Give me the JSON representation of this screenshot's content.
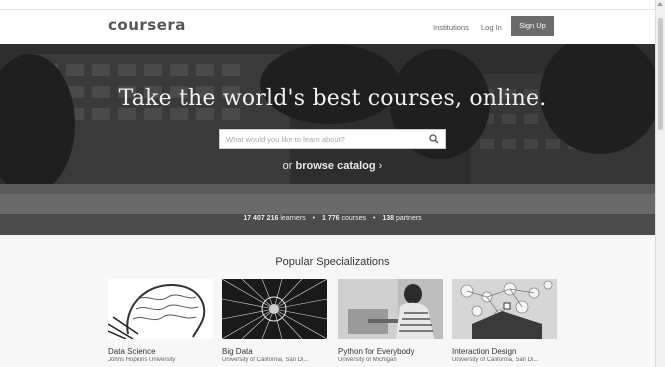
{
  "nav": {
    "logo": "coursera",
    "institutions": "Institutions",
    "login": "Log In",
    "signup": "Sign Up"
  },
  "hero": {
    "title": "Take the world's best courses, online.",
    "search_placeholder": "What would you like to learn about?",
    "browse_prefix": "or",
    "browse_link": "browse catalog",
    "browse_arrow": "›",
    "stats": {
      "learners_num": "17 407 216",
      "learners_label": "learners",
      "courses_num": "1 776",
      "courses_label": "courses",
      "partners_num": "138",
      "partners_label": "partners",
      "separator": "•"
    }
  },
  "specializations": {
    "title": "Popular Specializations",
    "cards": [
      {
        "title": "Data Science",
        "subtitle": "Johns Hopkins University"
      },
      {
        "title": "Big Data",
        "subtitle": "University of California, San Di..."
      },
      {
        "title": "Python for Everybody",
        "subtitle": "University of Michigan"
      },
      {
        "title": "Interaction Design",
        "subtitle": "University of California, San Di..."
      }
    ]
  },
  "colors": {
    "signup_bg": "#6b6b6b",
    "hero_text": "#f2f2f2"
  }
}
